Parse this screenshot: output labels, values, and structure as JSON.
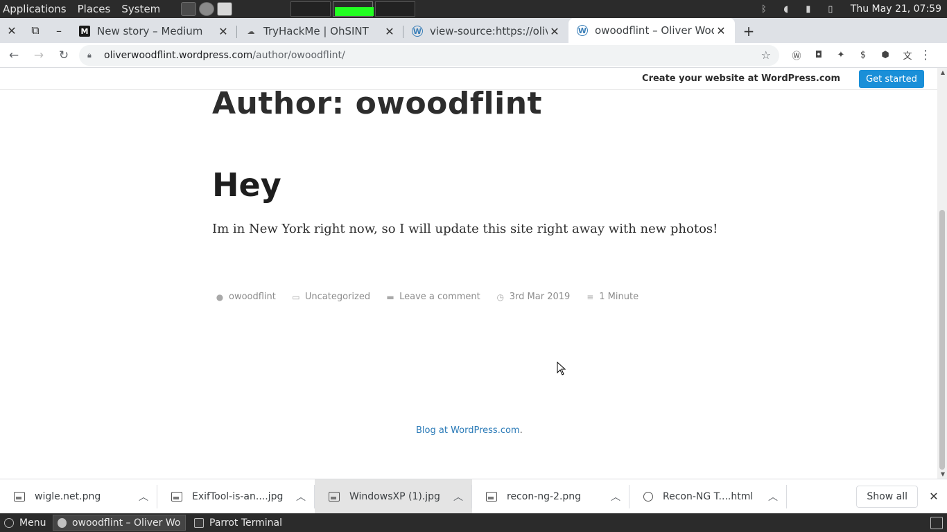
{
  "system_panel": {
    "menus": [
      "Applications",
      "Places",
      "System"
    ],
    "clock": "Thu May 21, 07:59"
  },
  "tabs": [
    {
      "title": "New story – Medium",
      "favicon": "medium-icon",
      "active": false
    },
    {
      "title": "TryHackMe | OhSINT",
      "favicon": "cloud-icon",
      "active": false
    },
    {
      "title": "view-source:https://oliver",
      "favicon": "wordpress-icon",
      "active": false
    },
    {
      "title": "owoodflint – Oliver Wood",
      "favicon": "wordpress-icon",
      "active": true
    }
  ],
  "address_bar": {
    "host": "oliverwoodflint.wordpress.com",
    "path": "/author/owoodflint/"
  },
  "wp_bar": {
    "create_text": "Create your website at WordPress.com",
    "cta": "Get started"
  },
  "page": {
    "author_heading": "Author: owoodflint",
    "post_title": "Hey",
    "post_text": "Im in New York right now, so I will update this site right away with new photos!",
    "meta": {
      "author": "owoodflint",
      "category": "Uncategorized",
      "comment": "Leave a comment",
      "date": "3rd Mar 2019",
      "read_time": "1 Minute"
    },
    "footer_link": "Blog at WordPress.com",
    "footer_suffix": "."
  },
  "downloads": {
    "items": [
      {
        "name": "wigle.net.png"
      },
      {
        "name": "ExifTool-is-an....jpg"
      },
      {
        "name": "WindowsXP (1).jpg"
      },
      {
        "name": "recon-ng-2.png"
      },
      {
        "name": "Recon-NG T....html"
      }
    ],
    "show_all": "Show all"
  },
  "taskbar": {
    "menu": "Menu",
    "tasks": [
      "owoodflint – Oliver Wo...",
      "Parrot Terminal"
    ]
  },
  "colors": {
    "wp_blue": "#1a8fd8",
    "link_blue": "#2a7ab7",
    "workspace_active": "#22ff22"
  }
}
